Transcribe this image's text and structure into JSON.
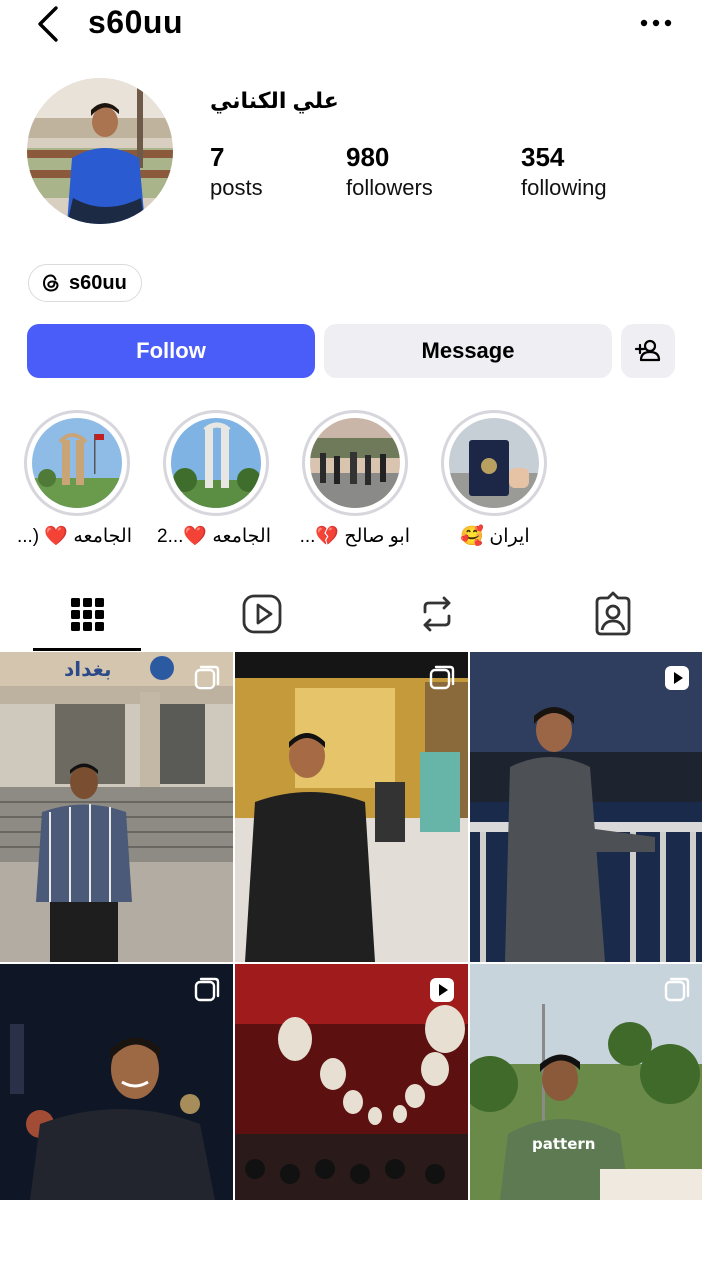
{
  "header": {
    "username": "s60uu",
    "back_icon": "chevron-left-icon",
    "more_icon": "more-horizontal-icon"
  },
  "profile": {
    "full_name": "علي الكناني",
    "stats": [
      {
        "value": "7",
        "label": "posts"
      },
      {
        "value": "980",
        "label": "followers"
      },
      {
        "value": "354",
        "label": "following"
      }
    ],
    "threads_handle": "s60uu"
  },
  "actions": {
    "follow": "Follow",
    "message": "Message",
    "add_person_icon": "add-person-icon"
  },
  "colors": {
    "follow_bg": "#4a5df9",
    "secondary_bg": "#efeff3",
    "heart": "#e02b3c"
  },
  "highlights": [
    {
      "label": "الجامعه ❤️ (..."
    },
    {
      "label": "الجامعه ❤️...2"
    },
    {
      "label": "ابو صالح 💔..."
    },
    {
      "label": "ايران 🥰"
    }
  ],
  "tabs": [
    {
      "name": "grid",
      "icon": "grid-icon",
      "active": true
    },
    {
      "name": "reels",
      "icon": "reels-icon"
    },
    {
      "name": "reposts",
      "icon": "repost-icon"
    },
    {
      "name": "tagged",
      "icon": "tagged-person-icon"
    }
  ],
  "posts": [
    {
      "type": "carousel",
      "sign_text": "بغداد"
    },
    {
      "type": "carousel"
    },
    {
      "type": "reel"
    },
    {
      "type": "carousel"
    },
    {
      "type": "reel"
    },
    {
      "type": "carousel",
      "shirt_text": "pattern"
    }
  ]
}
